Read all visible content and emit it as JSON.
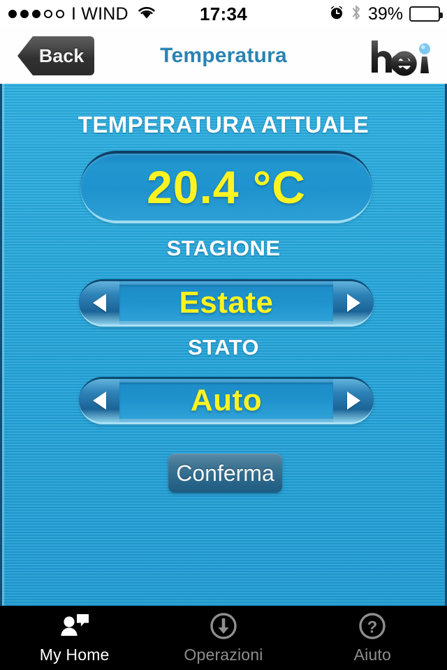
{
  "statusbar": {
    "signal_dots_filled": 3,
    "signal_dots_total": 5,
    "carrier": "I WIND",
    "wifi_icon": "wifi-icon",
    "time": "17:34",
    "alarm_icon": "alarm-clock-icon",
    "bluetooth_icon": "bluetooth-icon",
    "battery_percent": "39%",
    "battery_level": 39
  },
  "navbar": {
    "back_label": "Back",
    "title": "Temperatura",
    "logo_text": "hei",
    "logo_dot_color": "#7ec8ef",
    "title_color": "#2a83b2"
  },
  "main": {
    "temperature": {
      "label": "TEMPERATURA ATTUALE",
      "value": "20.4 °C"
    },
    "season": {
      "label": "STAGIONE",
      "value": "Estate",
      "prev_icon": "arrow-left-icon",
      "next_icon": "arrow-right-icon"
    },
    "state": {
      "label": "STATO",
      "value": "Auto",
      "prev_icon": "arrow-left-icon",
      "next_icon": "arrow-right-icon"
    },
    "confirm_label": "Conferma",
    "value_color": "#fbf322",
    "panel_color": "#23a3d8"
  },
  "tabbar": {
    "tabs": [
      {
        "label": "My Home",
        "icon": "person-speech-bubble-icon",
        "active": true
      },
      {
        "label": "Operazioni",
        "icon": "download-circle-icon",
        "active": false
      },
      {
        "label": "Aiuto",
        "icon": "question-circle-icon",
        "active": false
      }
    ]
  }
}
